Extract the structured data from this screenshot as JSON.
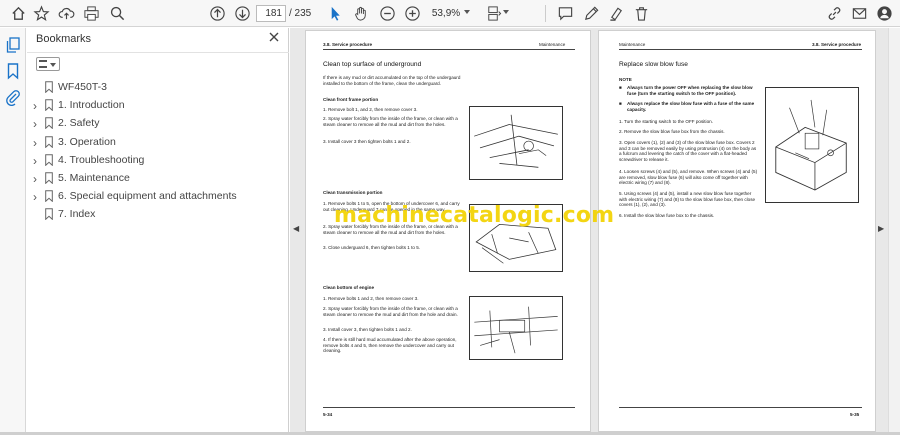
{
  "toolbar": {
    "current_page": "181",
    "total_pages": "/ 235",
    "zoom": "53,9%"
  },
  "bookmarks": {
    "title": "Bookmarks",
    "items": [
      {
        "label": "WF450T-3",
        "expandable": false
      },
      {
        "label": "1.  Introduction",
        "expandable": true
      },
      {
        "label": "2.  Safety",
        "expandable": true
      },
      {
        "label": "3.  Operation",
        "expandable": true
      },
      {
        "label": "4.  Troubleshooting",
        "expandable": true
      },
      {
        "label": "5.  Maintenance",
        "expandable": true
      },
      {
        "label": "6.  Special equipment and attachments",
        "expandable": true
      },
      {
        "label": "7.  Index",
        "expandable": false
      }
    ]
  },
  "watermark": "machinecatalogic.com",
  "left_page": {
    "header_left": "3.8.  Service procedure",
    "header_right": "Maintenance",
    "section_title": "Clean top surface of underground",
    "intro": "If there is any mud or dirt accumulated on the top of the undergaurd installed to the bottom of the frame, clean the underguard.",
    "sub1": "Clean front frame portion",
    "sub1_steps": [
      "1.  Remove bolt 1, and 2, then remove cover 3.",
      "2.  Spray water forcibly from the inside of the frame, or clean with a steam cleaner to remove all the mud and dirt from the holes.",
      "3.  Install cover 3 then tighten bolts 1 and 2."
    ],
    "sub2": "Clean transmission portion",
    "sub2_steps": [
      "1.  Remove bolts 1 to 5, open the bottom of undercover 6, and carry out cleaning. Underguard 7 can be opened in the same way.",
      "2.  Spray water forcibly from the inside of the frame, or clean with a steam cleaner to remove all the mud and dirt from the holes.",
      "3.  Close underguard 6, then tighten bolts 1 to 5."
    ],
    "sub3": "Clean bottom of engine",
    "sub3_steps": [
      "1.  Remove bolts 1 and 2, then remove cover 3.",
      "2.  Spray water forcibly from the inside of the frame, or clean with a steam cleaner to remove the mud and dirt from the hole and drain.",
      "3.  Install cover 3, then tighten bolts 1 and 2.",
      "4.  If there is still hard mud accumulated after the above operation, remove bolts 4 and 5, then remove the undercover and carry out cleaning."
    ],
    "footer": "5-34"
  },
  "right_page": {
    "header_left": "Maintenance",
    "header_right": "3.8.  Service procedure",
    "section_title": "Replace slow blow fuse",
    "note_label": "NOTE",
    "notes": [
      "Always turn the power OFF when replacing the slow blow fuse (turn the starting switch to the OFF position).",
      "Always replace the slow blow fuse with a fuse of the same capacity."
    ],
    "steps": [
      "1.  Turn the starting switch to the OFF position.",
      "2.  Remove the slow blow fuse box from the chassis.",
      "3.  Open covers (1), (2) and (3) of the slow blow fuse box. Covers 2 and 3 can be removed easily by using protrusion (4) on the body as a fulcrum and levering the catch of the cover with a flat-headed screwdriver to release it.",
      "4.  Loosen screws (4) and (5), and remove. When screws (4) and (5) are removed, slow blow fuse (6) will also come off together with electric wiring (7) and (8).",
      "5.  Using screws (4) and (5), install a new slow blow fuse together with electric wiring (7) and (8) to the slow blow fuse box, then close covers (1), (2), and (3).",
      "6.  Install the slow blow fuse box to the chassis."
    ],
    "footer": "5-35"
  }
}
